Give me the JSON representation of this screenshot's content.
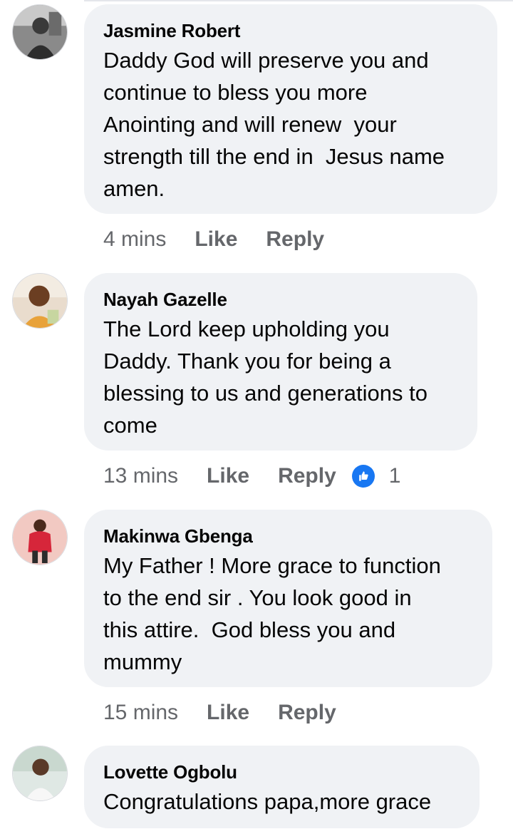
{
  "comments": [
    {
      "author": "Jasmine Robert",
      "text": "Daddy God will preserve you and\ncontinue to bless you more\nAnointing and will renew  your\nstrength till the end in  Jesus name\namen.",
      "time": "4 mins",
      "like": "Like",
      "reply": "Reply"
    },
    {
      "author": "Nayah Gazelle",
      "text": "The Lord keep upholding you\nDaddy. Thank you for being a\nblessing to us and generations to\ncome",
      "time": "13 mins",
      "like": "Like",
      "reply": "Reply",
      "reaction_count": "1"
    },
    {
      "author": "Makinwa Gbenga",
      "text": "My Father ! More grace to function\nto the end sir . You look good in\nthis attire.  God bless you and\nmummy",
      "time": "15 mins",
      "like": "Like",
      "reply": "Reply"
    },
    {
      "author": "Lovette Ogbolu",
      "text": "Congratulations papa,more grace"
    }
  ],
  "colors": {
    "bubble": "#f0f2f5",
    "meta": "#65676b",
    "like_reaction": "#1877f2"
  },
  "icons": {
    "reaction": "thumbs-up-icon"
  }
}
